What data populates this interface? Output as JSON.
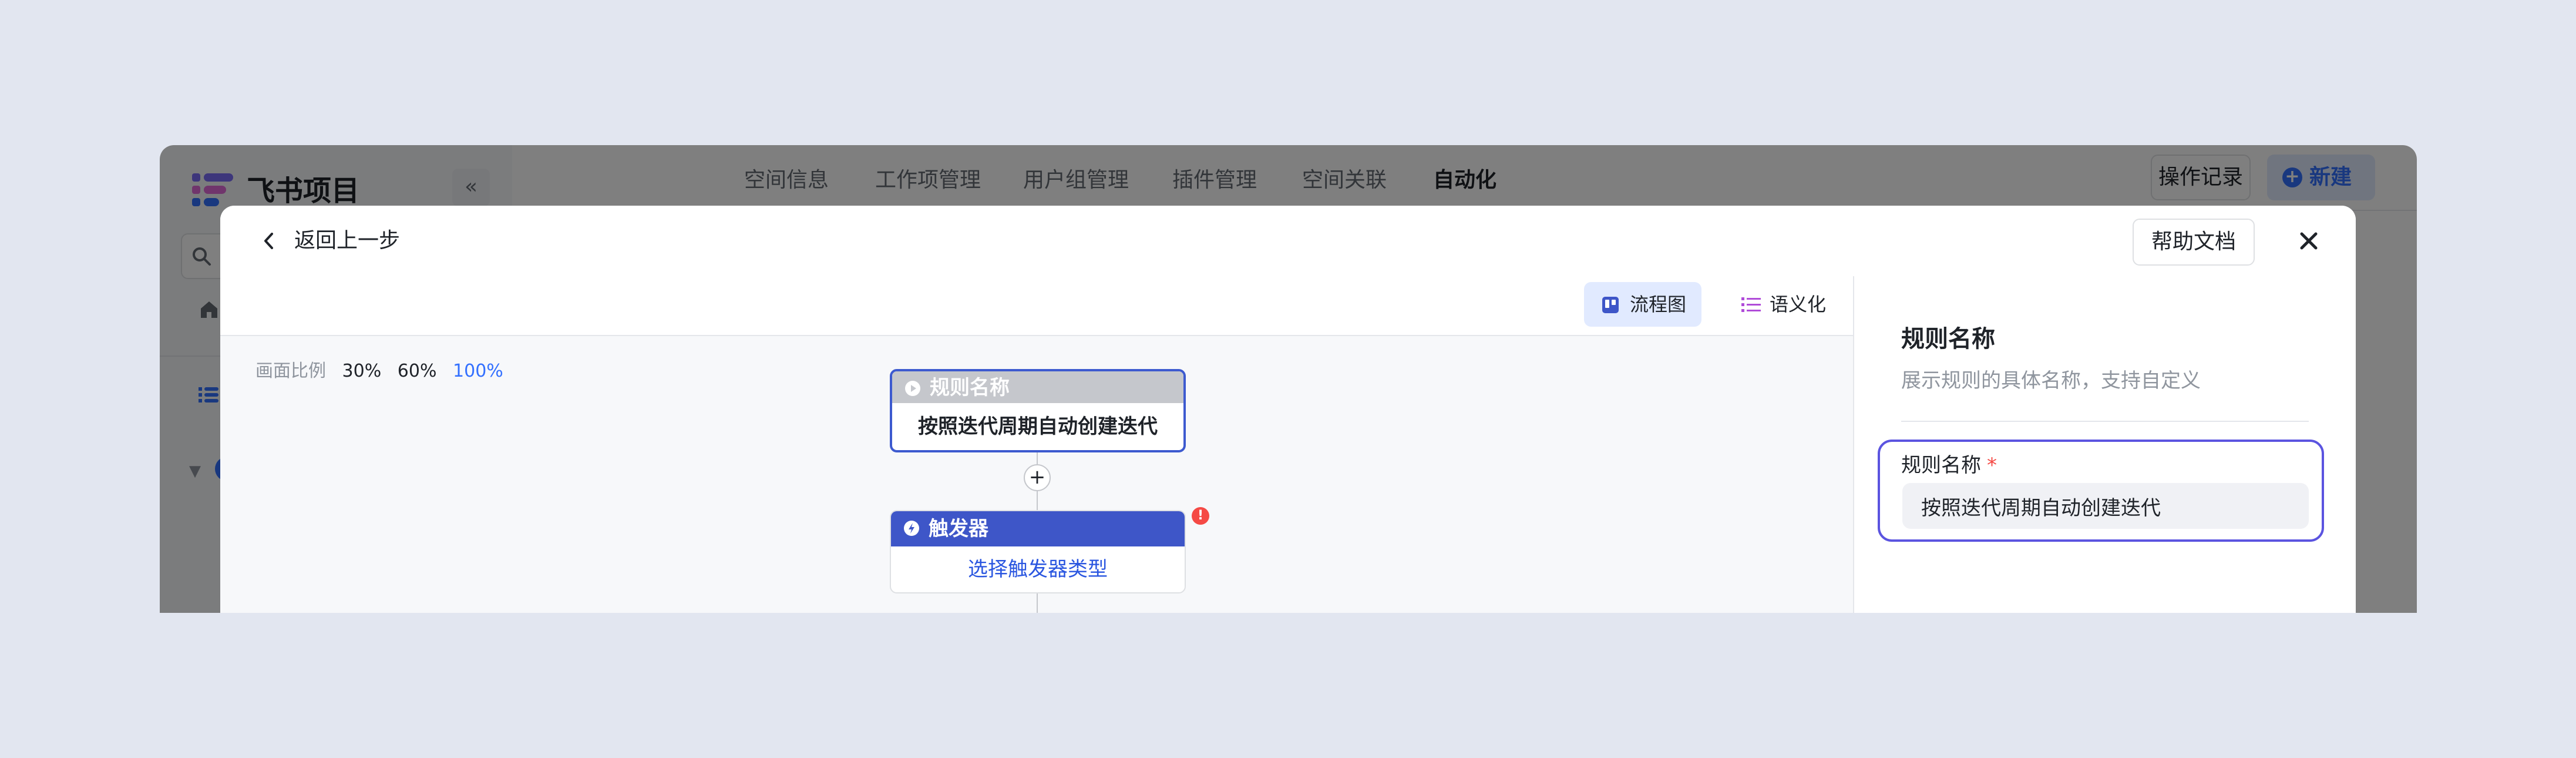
{
  "app": {
    "logo_text": "飞书项目",
    "collapse_icon": "«",
    "nav_tabs": [
      {
        "label": "空间信息",
        "active": false
      },
      {
        "label": "工作项管理",
        "active": false
      },
      {
        "label": "用户组管理",
        "active": false
      },
      {
        "label": "插件管理",
        "active": false
      },
      {
        "label": "空间关联",
        "active": false
      },
      {
        "label": "自动化",
        "active": true
      }
    ],
    "ops_button": "操作记录",
    "new_button": "新建"
  },
  "modal": {
    "back_label": "返回上一步",
    "help_button": "帮助文档",
    "view_toggle": {
      "flowchart": "流程图",
      "semantic": "语义化",
      "active": "flowchart"
    },
    "zoom": {
      "label": "画面比例",
      "options": [
        "30%",
        "60%",
        "100%"
      ],
      "active": "100%"
    },
    "nodes": {
      "rule": {
        "header": "规则名称",
        "body": "按照迭代周期自动创建迭代"
      },
      "add_symbol": "+",
      "trigger": {
        "header": "触发器",
        "body": "选择触发器类型",
        "error_mark": "!"
      }
    },
    "panel": {
      "title": "规则名称",
      "description": "展示规则的具体名称，支持自定义",
      "field_label": "规则名称",
      "required_mark": "*",
      "field_value": "按照迭代周期自动创建迭代"
    }
  },
  "colors": {
    "accent": "#3370ff",
    "trigger_header": "#3e56c8",
    "rule_header": "#c5c7cc",
    "field_focus": "#5b54e0",
    "error": "#f54a45"
  }
}
